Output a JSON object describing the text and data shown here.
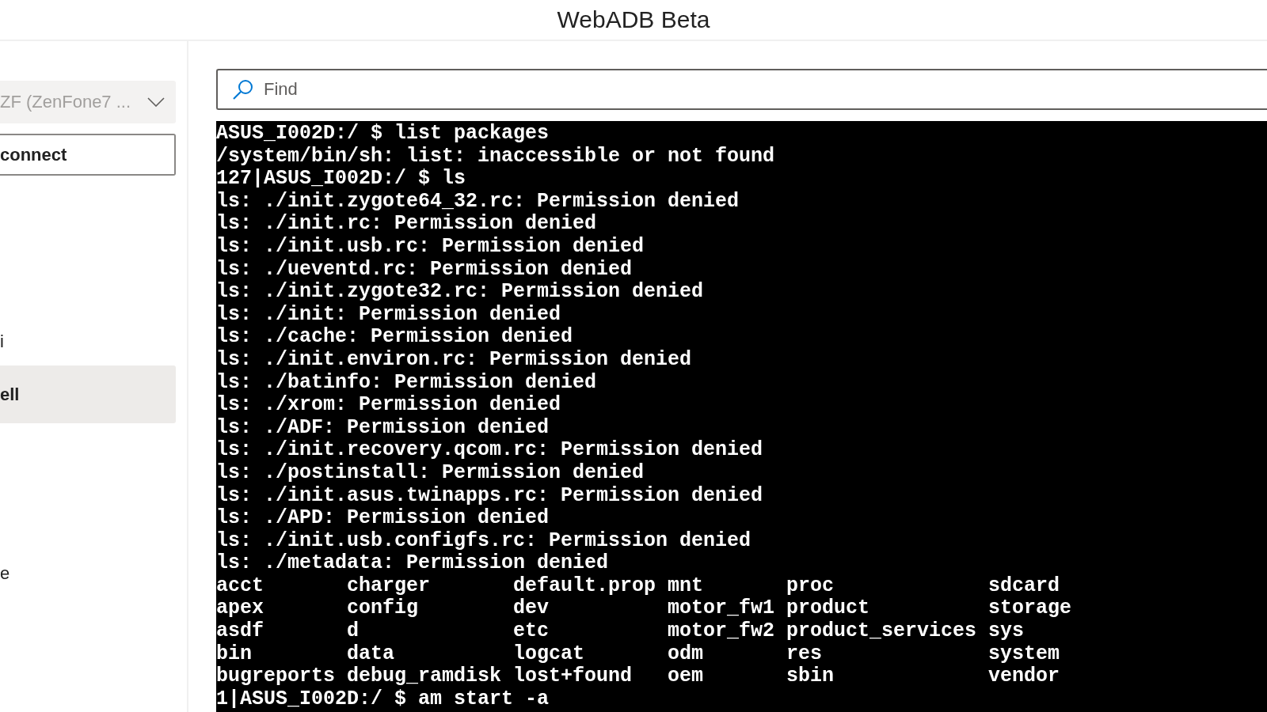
{
  "window": {
    "title": "WebADB Beta"
  },
  "sidebar": {
    "device_select": {
      "value": "ZF (ZenFone7 ..."
    },
    "connect_button": {
      "label": "connect"
    },
    "items": [
      {
        "label": "i",
        "selected": false
      },
      {
        "label": "ell",
        "selected": true
      },
      {
        "label": "e",
        "selected": false
      }
    ]
  },
  "search": {
    "placeholder": "Find"
  },
  "terminal": {
    "lines": [
      "ASUS_I002D:/ $ list packages",
      "/system/bin/sh: list: inaccessible or not found",
      "127|ASUS_I002D:/ $ ls",
      "ls: ./init.zygote64_32.rc: Permission denied",
      "ls: ./init.rc: Permission denied",
      "ls: ./init.usb.rc: Permission denied",
      "ls: ./ueventd.rc: Permission denied",
      "ls: ./init.zygote32.rc: Permission denied",
      "ls: ./init: Permission denied",
      "ls: ./cache: Permission denied",
      "ls: ./init.environ.rc: Permission denied",
      "ls: ./batinfo: Permission denied",
      "ls: ./xrom: Permission denied",
      "ls: ./ADF: Permission denied",
      "ls: ./init.recovery.qcom.rc: Permission denied",
      "ls: ./postinstall: Permission denied",
      "ls: ./init.asus.twinapps.rc: Permission denied",
      "ls: ./APD: Permission denied",
      "ls: ./init.usb.configfs.rc: Permission denied",
      "ls: ./metadata: Permission denied"
    ],
    "listing": [
      [
        "acct",
        "charger",
        "default.prop",
        "mnt",
        "proc",
        "sdcard"
      ],
      [
        "apex",
        "config",
        "dev",
        "motor_fw1",
        "product",
        "storage"
      ],
      [
        "asdf",
        "d",
        "etc",
        "motor_fw2",
        "product_services",
        "sys"
      ],
      [
        "bin",
        "data",
        "logcat",
        "odm",
        "res",
        "system"
      ],
      [
        "bugreports",
        "debug_ramdisk",
        "lost+found",
        "oem",
        "sbin",
        "vendor"
      ]
    ],
    "prompt": "1|ASUS_I002D:/ $ am start -a"
  }
}
